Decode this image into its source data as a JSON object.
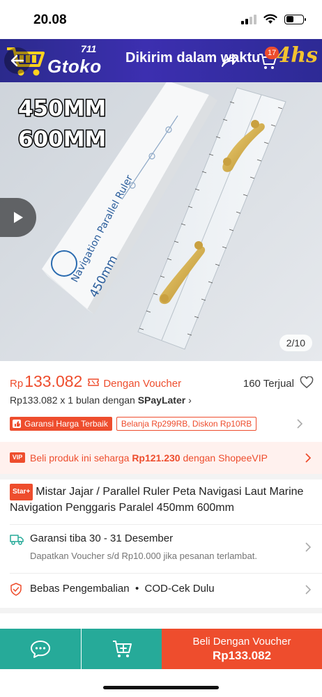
{
  "status_bar": {
    "time": "20.08"
  },
  "banner": {
    "logo_number": "711",
    "logo_name": "Gtoko",
    "text": "Dikirim dalam waktu",
    "brand": "4hs",
    "cart_count": "17"
  },
  "image": {
    "size_line_1": "450MM",
    "size_line_2": "600MM",
    "counter": "2/10"
  },
  "price": {
    "currency": "Rp",
    "amount": "133.082",
    "voucher_label": "Dengan Voucher",
    "sold": "160 Terjual"
  },
  "paylater": {
    "text": "Rp133.082 x 1 bulan dengan ",
    "brand": "SPayLater",
    "arrow": "›"
  },
  "tags": {
    "best_price": "Garansi Harga Terbaik",
    "discount": "Belanja Rp299RB, Diskon Rp10RB"
  },
  "vip": {
    "badge": "VIP",
    "text_before": "Beli produk ini seharga ",
    "price": "Rp121.230",
    "text_after": " dengan ShopeeVIP"
  },
  "product": {
    "badge": "Star+",
    "title": "Mistar Jajar / Parallel Ruler Peta Navigasi Laut Marine Navigation Penggaris Paralel 450mm 600mm"
  },
  "shipping": {
    "title": "Garansi tiba 30 - 31 Desember",
    "subtitle": "Dapatkan Voucher s/d Rp10.000 jika pesanan terlambat."
  },
  "returns": {
    "text": "Bebas Pengembalian  •  COD-Cek Dulu"
  },
  "bottom_bar": {
    "buy_label": "Beli Dengan Voucher",
    "buy_price": "Rp133.082"
  },
  "colors": {
    "accent": "#ee4d2d",
    "teal": "#26aa99",
    "vip_bg": "#fff1ee",
    "banner": "#2d2a95"
  }
}
